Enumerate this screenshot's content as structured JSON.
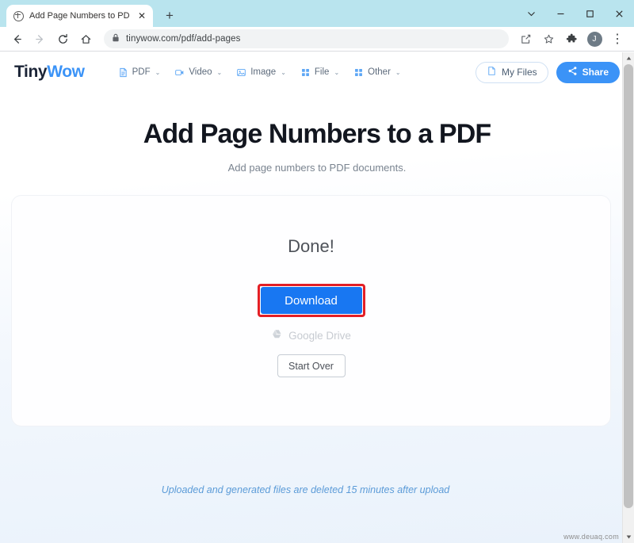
{
  "browser": {
    "tab": {
      "title": "Add Page Numbers to PDF Free (",
      "favicon": "globe-icon",
      "close": "✕"
    },
    "newtab_label": "+",
    "window_controls": [
      {
        "name": "chevron-down-icon",
        "glyph": "⌄"
      },
      {
        "name": "minimize-icon",
        "glyph": "–"
      },
      {
        "name": "maximize-icon",
        "glyph": "□"
      },
      {
        "name": "close-icon",
        "glyph": "✕"
      }
    ],
    "toolbar": {
      "back": "←",
      "forward": "→",
      "reload": "⟳",
      "home": "⌂",
      "lock": "lock-icon",
      "url": "tinywow.com/pdf/add-pages",
      "share": "share-icon",
      "bookmark": "☆",
      "extensions": "puzzle-icon",
      "profile_initial": "J",
      "menu": "⋮"
    }
  },
  "site": {
    "logo": {
      "part1": "Tiny",
      "part2": "Wow"
    },
    "nav": [
      {
        "label": "PDF",
        "icon": "document-icon",
        "chevron": "⌄"
      },
      {
        "label": "Video",
        "icon": "video-camera-icon",
        "chevron": "⌄"
      },
      {
        "label": "Image",
        "icon": "image-icon",
        "chevron": "⌄"
      },
      {
        "label": "File",
        "icon": "grid-icon",
        "chevron": "⌄"
      },
      {
        "label": "Other",
        "icon": "grid-icon",
        "chevron": "⌄"
      }
    ],
    "my_files_label": "My Files",
    "share_label": "Share"
  },
  "hero": {
    "title": "Add Page Numbers to a PDF",
    "subtitle": "Add page numbers to PDF documents."
  },
  "card": {
    "status": "Done!",
    "download_label": "Download",
    "google_drive_label": "Google Drive",
    "start_over_label": "Start Over"
  },
  "footer_note": "Uploaded and generated files are deleted 15 minutes after upload",
  "watermark": "www.deuaq.com",
  "colors": {
    "accent_blue": "#3b93f7",
    "download_blue": "#1877f2",
    "highlight_red": "#e31f26",
    "tabstrip": "#b9e4ee",
    "note_blue": "#5b9bd8"
  }
}
